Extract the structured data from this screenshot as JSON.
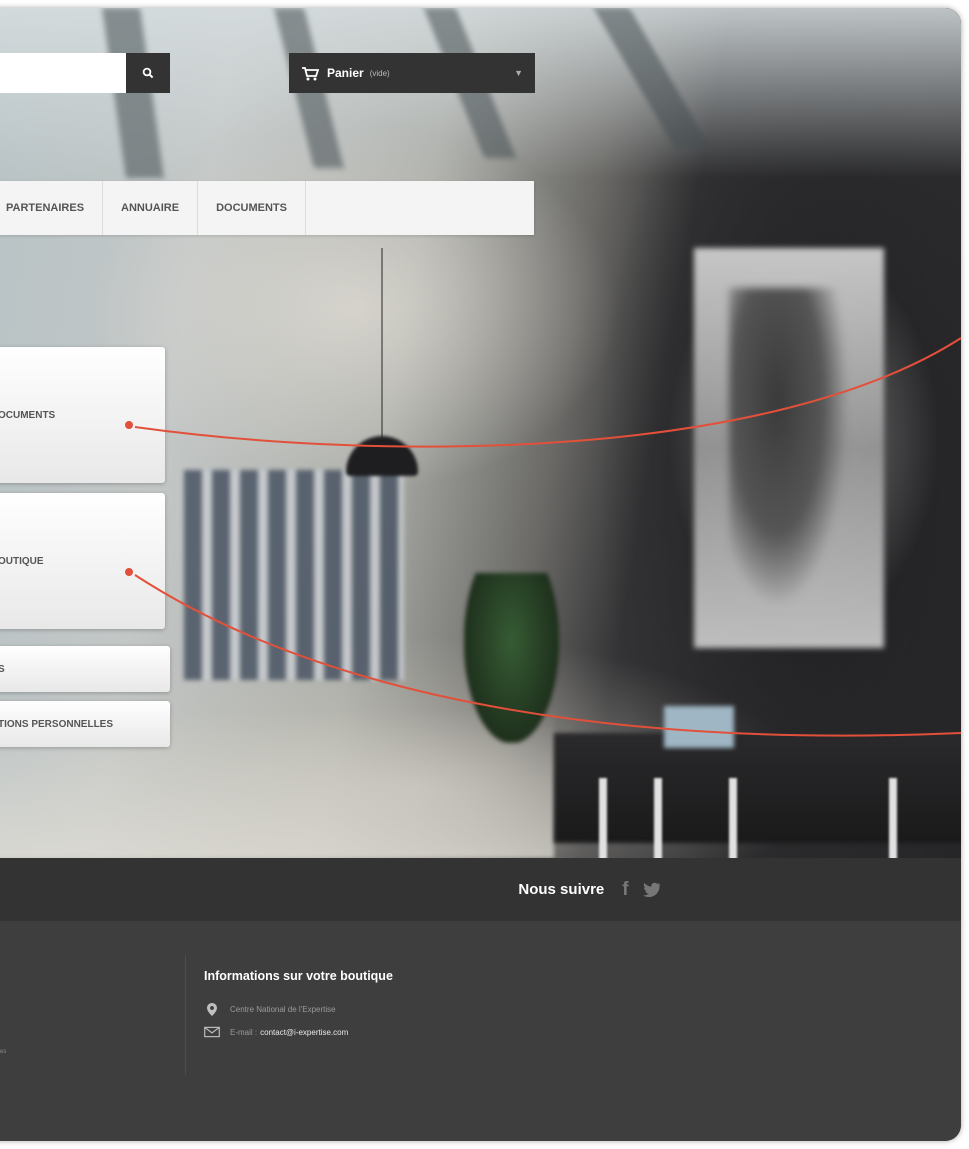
{
  "header": {
    "search": {
      "placeholder": "",
      "button_icon": "search-icon"
    },
    "cart": {
      "icon": "cart-icon",
      "label": "Panier",
      "status": "(vide)",
      "caret_icon": "chevron-down-icon"
    }
  },
  "menu": {
    "items": [
      {
        "label": "PARTENAIRES"
      },
      {
        "label": "ANNUAIRE"
      },
      {
        "label": "DOCUMENTS"
      }
    ]
  },
  "account_links": [
    {
      "label": "OCUMENTS"
    },
    {
      "label": "OUTIQUE"
    },
    {
      "label": "S"
    },
    {
      "label": "TIONS PERSONNELLES"
    }
  ],
  "callout_color": "#e3503a",
  "follow": {
    "label": "Nous suivre",
    "facebook_icon": "f",
    "twitter_icon": "twitter-icon"
  },
  "footer": {
    "store_info_title": "Informations sur votre boutique",
    "address": "Centre National de l'Expertise",
    "email_label": "E-mail :",
    "email_value": "contact@i-expertise.com",
    "left_stub": "es"
  }
}
